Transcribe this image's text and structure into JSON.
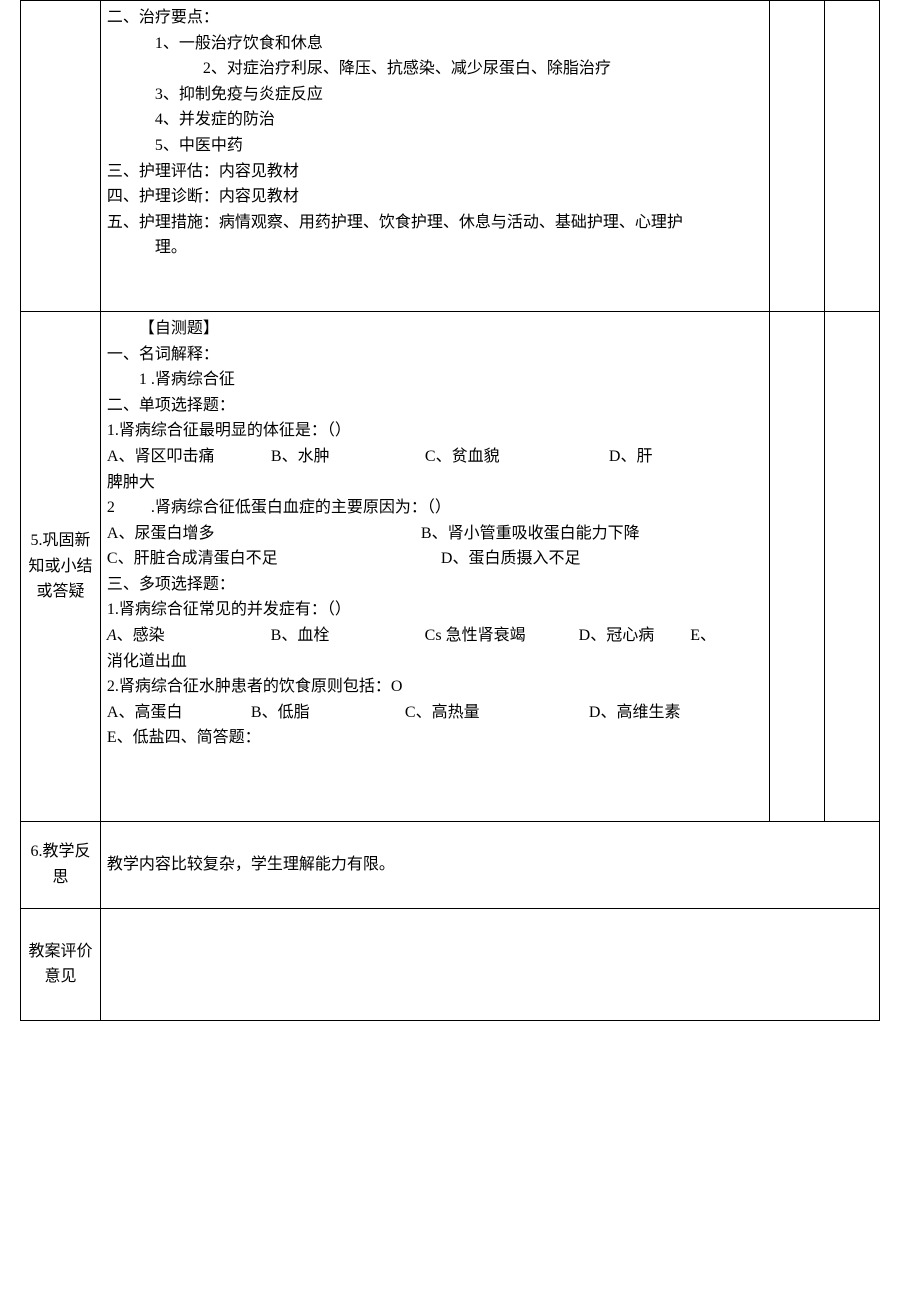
{
  "row1": {
    "label": "",
    "lines": [
      {
        "text": "二、治疗要点：",
        "indent": 0
      },
      {
        "text": "1、一般治疗饮食和休息",
        "indent": 1
      },
      {
        "text": "2、对症治疗利尿、降压、抗感染、减少尿蛋白、除脂治疗",
        "indent": 2
      },
      {
        "text": "3、抑制免疫与炎症反应",
        "indent": 1
      },
      {
        "text": "4、并发症的防治",
        "indent": 1
      },
      {
        "text": "5、中医中药",
        "indent": 1
      },
      {
        "text": "三、护理评估：内容见教材",
        "indent": 0
      },
      {
        "text": "四、护理诊断：内容见教材",
        "indent": 0
      },
      {
        "text": "五、护理措施：病情观察、用药护理、饮食护理、休息与活动、基础护理、心理护理。",
        "indent": 0,
        "hang": true
      }
    ]
  },
  "row2": {
    "label": "5.巩固新知或小结或答疑",
    "selfTestTitle": "【自测题】",
    "section1": {
      "title": "一、名词解释：",
      "item": "1  .肾病综合征"
    },
    "section2": {
      "title": "二、单项选择题：",
      "q1": {
        "stem": "1.肾病综合征最明显的体征是：（）",
        "optA": "A、肾区叩击痛",
        "optB": "B、水肿",
        "optC": "C、贫血貌",
        "optD": "D、肝",
        "cont": "脾肿大"
      },
      "q2": {
        "stem": "2　　  .肾病综合征低蛋白血症的主要原因为：（）",
        "optA": "A、尿蛋白增多",
        "optB": "B、肾小管重吸收蛋白能力下降",
        "optC": "C、肝脏合成清蛋白不足",
        "optD": "D、蛋白质摄入不足"
      }
    },
    "section3": {
      "title": "三、多项选择题：",
      "q1": {
        "stem": "1.肾病综合征常见的并发症有：（）",
        "optA_prefix": "A",
        "optA_text": "、感染",
        "optB": "B、血栓",
        "optC": "Cs 急性肾衰竭",
        "optD": "D、冠心病",
        "optE": "E、",
        "cont": "消化道出血"
      },
      "q2": {
        "stem": "2.肾病综合征水肿患者的饮食原则包括：O",
        "optA": "A、高蛋白",
        "optB": "B、低脂",
        "optC": "C、高热量",
        "optD": "D、高维生素",
        "optE": "E、低盐四、简答题："
      }
    }
  },
  "row3": {
    "label": "6.教学反思",
    "content": "教学内容比较复杂，学生理解能力有限。"
  },
  "row4": {
    "label": "教案评价意见",
    "content": ""
  }
}
